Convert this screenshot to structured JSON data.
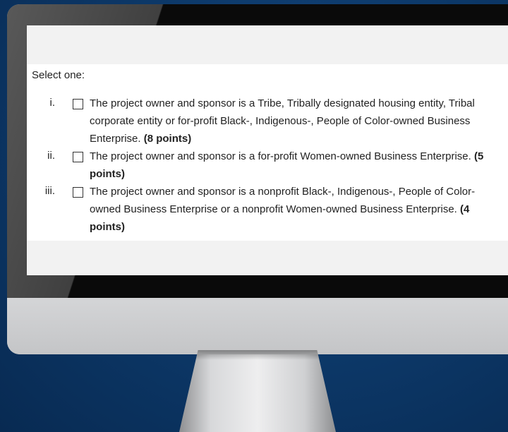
{
  "form": {
    "prompt": "Select one:",
    "options": [
      {
        "numeral": "i.",
        "text": "The project owner and sponsor is a Tribe, Tribally designated housing entity, Tribal corporate entity or for-profit Black-, Indigenous-, People of Color-owned Business Enterprise.",
        "points": "(8 points)",
        "checked": false
      },
      {
        "numeral": "ii.",
        "text": "The project owner and sponsor is a for-profit Women-owned Business Enterprise.",
        "points": "(5 points)",
        "checked": false
      },
      {
        "numeral": "iii.",
        "text": "The project owner and sponsor is a nonprofit Black-, Indigenous-, People of Color-owned Business Enterprise or a nonprofit Women-owned Business Enterprise.",
        "points": "(4 points)",
        "checked": false
      }
    ]
  },
  "colors": {
    "background": "#0c3766",
    "bezel": "#0a0a0a",
    "monitor_body": "#c6c7c9"
  }
}
